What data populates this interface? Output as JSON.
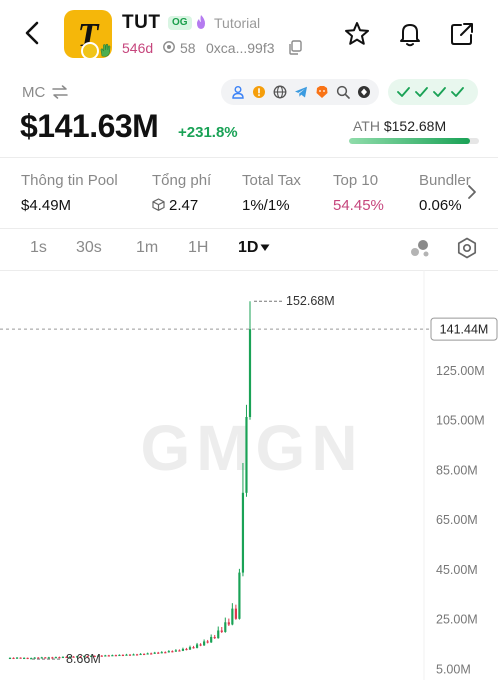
{
  "token": {
    "ticker": "TUT",
    "logo_letter": "T",
    "tag": "OG",
    "tag_label": "Tutorial",
    "age": "546d",
    "holders_count": "58",
    "address": "0xca...99f3"
  },
  "market": {
    "mc_label": "MC",
    "mc_value": "$141.63M",
    "mc_change": "+231.8%",
    "ath_label": "ATH",
    "ath_value": "$152.68M",
    "ath_progress": 0.93
  },
  "stats": [
    {
      "label": "Thông tin Pool",
      "value": "$4.49M"
    },
    {
      "label": "Tổng phí",
      "value": "2.47"
    },
    {
      "label": "Total Tax",
      "value": "1%/1%"
    },
    {
      "label": "Top 10",
      "value": "54.45%"
    },
    {
      "label": "Bundler",
      "value": "0.06%"
    }
  ],
  "timeframes": {
    "items": [
      "1s",
      "30s",
      "1m",
      "1H"
    ],
    "active": "1D"
  },
  "colors": {
    "up": "#1aa256",
    "down": "#e0364d",
    "accent_pink": "#c6467d",
    "logo_bg": "#f5b70a"
  },
  "chart_data": {
    "type": "candlestick",
    "watermark": "GMGN",
    "y_ticks": [
      "125.00M",
      "105.00M",
      "85.00M",
      "65.00M",
      "45.00M",
      "25.00M",
      "5.00M"
    ],
    "y_tick_values": [
      125,
      105,
      85,
      65,
      45,
      25,
      5
    ],
    "ylim": [
      3.5,
      158
    ],
    "current_price_label": "141.44M",
    "current_price": 141.44,
    "high_label": "152.68M",
    "high_value": 152.68,
    "low_label": "8.66M",
    "low_value": 8.66,
    "candles": [
      {
        "o": 9.0,
        "c": 9.2,
        "h": 9.4,
        "l": 8.8
      },
      {
        "o": 9.2,
        "c": 9.0,
        "h": 9.4,
        "l": 8.9
      },
      {
        "o": 9.0,
        "c": 9.3,
        "h": 9.5,
        "l": 8.9
      },
      {
        "o": 9.3,
        "c": 9.1,
        "h": 9.4,
        "l": 8.9
      },
      {
        "o": 9.1,
        "c": 9.2,
        "h": 9.4,
        "l": 9.0
      },
      {
        "o": 9.2,
        "c": 9.0,
        "h": 9.3,
        "l": 8.7
      },
      {
        "o": 9.0,
        "c": 9.1,
        "h": 9.3,
        "l": 8.9
      },
      {
        "o": 9.1,
        "c": 9.3,
        "h": 9.5,
        "l": 9.0
      },
      {
        "o": 9.3,
        "c": 9.2,
        "h": 9.5,
        "l": 9.0
      },
      {
        "o": 9.2,
        "c": 9.4,
        "h": 9.6,
        "l": 9.1
      },
      {
        "o": 9.4,
        "c": 9.2,
        "h": 9.5,
        "l": 9.0
      },
      {
        "o": 9.2,
        "c": 9.4,
        "h": 9.6,
        "l": 9.1
      },
      {
        "o": 9.4,
        "c": 9.3,
        "h": 9.6,
        "l": 9.1
      },
      {
        "o": 9.3,
        "c": 9.5,
        "h": 9.7,
        "l": 9.2
      },
      {
        "o": 9.5,
        "c": 9.4,
        "h": 9.7,
        "l": 9.2
      },
      {
        "o": 9.4,
        "c": 9.6,
        "h": 9.8,
        "l": 9.3
      },
      {
        "o": 9.6,
        "c": 9.5,
        "h": 9.8,
        "l": 9.3
      },
      {
        "o": 9.5,
        "c": 9.7,
        "h": 9.9,
        "l": 9.4
      },
      {
        "o": 9.7,
        "c": 9.6,
        "h": 9.9,
        "l": 9.4
      },
      {
        "o": 9.6,
        "c": 9.8,
        "h": 10.0,
        "l": 9.5
      },
      {
        "o": 9.8,
        "c": 9.7,
        "h": 10.0,
        "l": 9.5
      },
      {
        "o": 9.7,
        "c": 9.9,
        "h": 10.1,
        "l": 9.6
      },
      {
        "o": 9.9,
        "c": 9.8,
        "h": 10.1,
        "l": 9.6
      },
      {
        "o": 9.8,
        "c": 10.0,
        "h": 10.2,
        "l": 9.7
      },
      {
        "o": 10.0,
        "c": 9.9,
        "h": 10.2,
        "l": 9.7
      },
      {
        "o": 9.9,
        "c": 10.1,
        "h": 10.3,
        "l": 9.8
      },
      {
        "o": 10.1,
        "c": 10.0,
        "h": 10.3,
        "l": 9.8
      },
      {
        "o": 10.0,
        "c": 10.2,
        "h": 10.4,
        "l": 9.9
      },
      {
        "o": 10.2,
        "c": 10.1,
        "h": 10.4,
        "l": 9.9
      },
      {
        "o": 10.1,
        "c": 10.3,
        "h": 10.5,
        "l": 10.0
      },
      {
        "o": 10.3,
        "c": 10.2,
        "h": 10.5,
        "l": 10.0
      },
      {
        "o": 10.2,
        "c": 10.4,
        "h": 10.6,
        "l": 10.1
      },
      {
        "o": 10.4,
        "c": 10.3,
        "h": 10.6,
        "l": 10.1
      },
      {
        "o": 10.3,
        "c": 10.5,
        "h": 10.8,
        "l": 10.2
      },
      {
        "o": 10.5,
        "c": 10.4,
        "h": 10.7,
        "l": 10.2
      },
      {
        "o": 10.4,
        "c": 10.6,
        "h": 10.9,
        "l": 10.3
      },
      {
        "o": 10.6,
        "c": 10.5,
        "h": 10.8,
        "l": 10.3
      },
      {
        "o": 10.5,
        "c": 10.8,
        "h": 11.1,
        "l": 10.4
      },
      {
        "o": 10.8,
        "c": 10.7,
        "h": 11.0,
        "l": 10.5
      },
      {
        "o": 10.7,
        "c": 11.0,
        "h": 11.3,
        "l": 10.6
      },
      {
        "o": 11.0,
        "c": 10.9,
        "h": 11.3,
        "l": 10.7
      },
      {
        "o": 10.9,
        "c": 11.3,
        "h": 11.6,
        "l": 10.8
      },
      {
        "o": 11.3,
        "c": 11.1,
        "h": 11.6,
        "l": 10.9
      },
      {
        "o": 11.1,
        "c": 11.5,
        "h": 11.9,
        "l": 11.0
      },
      {
        "o": 11.5,
        "c": 11.4,
        "h": 11.8,
        "l": 11.1
      },
      {
        "o": 11.4,
        "c": 11.9,
        "h": 12.3,
        "l": 11.3
      },
      {
        "o": 11.9,
        "c": 11.7,
        "h": 12.2,
        "l": 11.4
      },
      {
        "o": 11.7,
        "c": 12.2,
        "h": 12.7,
        "l": 11.6
      },
      {
        "o": 12.2,
        "c": 12.0,
        "h": 12.6,
        "l": 11.8
      },
      {
        "o": 12.0,
        "c": 12.8,
        "h": 13.3,
        "l": 11.9
      },
      {
        "o": 12.8,
        "c": 12.5,
        "h": 13.2,
        "l": 12.2
      },
      {
        "o": 12.5,
        "c": 13.5,
        "h": 14.1,
        "l": 12.4
      },
      {
        "o": 13.5,
        "c": 13.2,
        "h": 14.0,
        "l": 12.9
      },
      {
        "o": 13.2,
        "c": 14.6,
        "h": 15.2,
        "l": 13.0
      },
      {
        "o": 14.6,
        "c": 14.2,
        "h": 15.1,
        "l": 13.9
      },
      {
        "o": 14.2,
        "c": 15.8,
        "h": 16.6,
        "l": 14.0
      },
      {
        "o": 15.8,
        "c": 15.4,
        "h": 16.4,
        "l": 15.0
      },
      {
        "o": 15.4,
        "c": 17.6,
        "h": 18.6,
        "l": 15.2
      },
      {
        "o": 17.6,
        "c": 17.1,
        "h": 18.4,
        "l": 16.8
      },
      {
        "o": 17.1,
        "c": 20.2,
        "h": 21.8,
        "l": 16.9
      },
      {
        "o": 20.2,
        "c": 19.6,
        "h": 21.6,
        "l": 19.2
      },
      {
        "o": 19.6,
        "c": 23.5,
        "h": 25.4,
        "l": 19.3
      },
      {
        "o": 23.5,
        "c": 22.6,
        "h": 25.0,
        "l": 22.0
      },
      {
        "o": 22.6,
        "c": 29.0,
        "h": 31.2,
        "l": 22.3
      },
      {
        "o": 29.0,
        "c": 24.9,
        "h": 30.6,
        "l": 24.5
      },
      {
        "o": 24.9,
        "c": 43.5,
        "h": 45.0,
        "l": 24.6
      },
      {
        "o": 43.5,
        "c": 75.6,
        "h": 87.6,
        "l": 42.0
      },
      {
        "o": 75.6,
        "c": 106.1,
        "h": 111.0,
        "l": 74.0
      },
      {
        "o": 106.1,
        "c": 141.44,
        "h": 152.68,
        "l": 105.0
      }
    ]
  }
}
